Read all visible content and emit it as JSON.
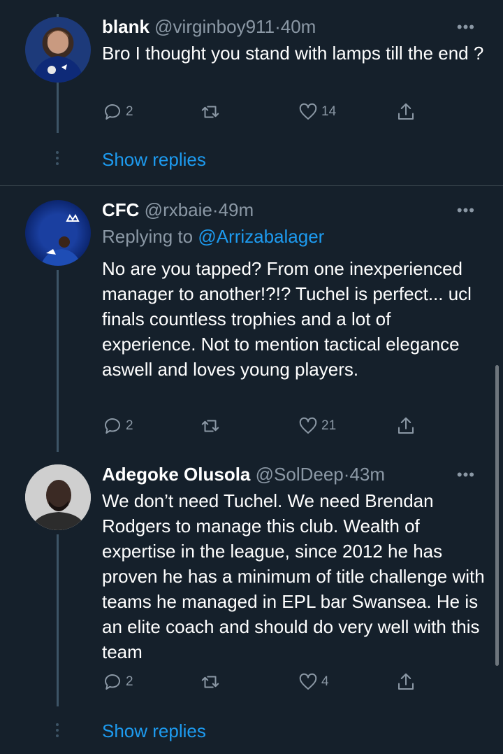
{
  "tweets": [
    {
      "display_name": "blank",
      "handle": "@virginboy911",
      "time_sep": "·",
      "time": "40m",
      "more": "•••",
      "text": "Bro I thought you stand with lamps till the end ?",
      "replies": "2",
      "retweets": "",
      "likes": "14",
      "show_replies": "Show replies"
    },
    {
      "display_name": "CFC",
      "handle": "@rxbaie",
      "time_sep": "·",
      "time": "49m",
      "more": "•••",
      "replying_prefix": "Replying to",
      "replying_handle": "@Arrizabalager",
      "text": "No are you tapped? From one inexperienced manager to another!?!? Tuchel is perfect... ucl finals countless trophies and a lot of experience. Not to mention tactical elegance aswell and loves young players.",
      "replies": "2",
      "retweets": "",
      "likes": "21"
    },
    {
      "display_name": "Adegoke Olusola",
      "handle": "@SolDeep",
      "time_sep": "·",
      "time": "43m",
      "more": "•••",
      "text": "We don’t need Tuchel. We need Brendan Rodgers to manage this club. Wealth of expertise in the league, since 2012 he has proven he has a minimum of title challenge with teams he managed in EPL bar Swansea. He is an elite coach and should do very well with this team",
      "replies": "2",
      "retweets": "",
      "likes": "4",
      "show_replies": "Show replies"
    }
  ],
  "icons": {
    "reply": "reply-icon",
    "retweet": "retweet-icon",
    "like": "heart-icon",
    "share": "share-icon",
    "more": "more-icon"
  },
  "colors": {
    "background": "#15202b",
    "link": "#1d9bf0",
    "muted": "#8b98a5",
    "divider": "#38444d"
  }
}
